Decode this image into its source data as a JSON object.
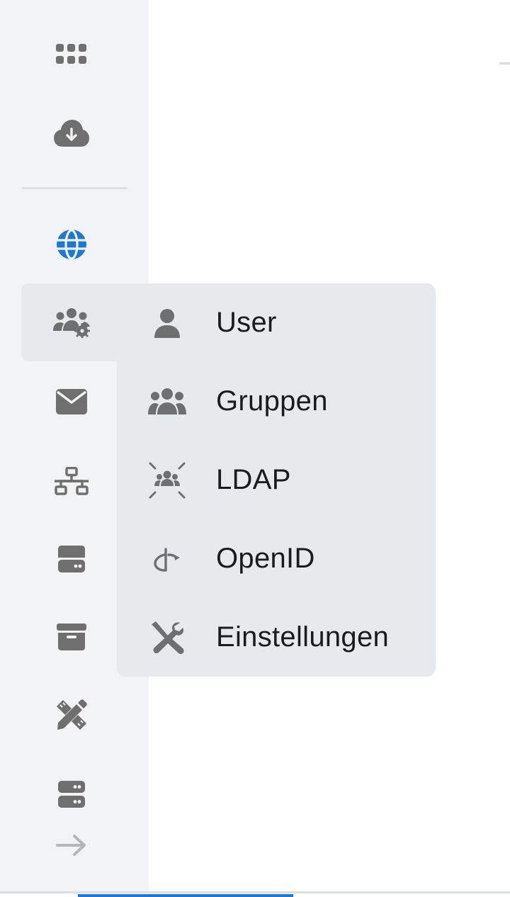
{
  "colors": {
    "icon": "#6f6f6f",
    "icon_active": "#1d78d3",
    "sidebar_bg": "#f2f3f5",
    "flyout_bg": "#e7eaed",
    "accent": "#1d78d3"
  },
  "sidebar": {
    "items": [
      {
        "icon": "apps-grid-icon"
      },
      {
        "icon": "cloud-download-icon"
      },
      {
        "icon": "globe-icon",
        "active_color": true
      },
      {
        "icon": "users-settings-icon",
        "selected": true
      },
      {
        "icon": "mail-icon"
      },
      {
        "icon": "network-icon"
      },
      {
        "icon": "storage-icon"
      },
      {
        "icon": "archive-icon"
      },
      {
        "icon": "tools-icon"
      },
      {
        "icon": "server-icon"
      },
      {
        "icon": "arrow-right-icon"
      }
    ]
  },
  "flyout": {
    "items": [
      {
        "label": "User",
        "icon": "user-icon"
      },
      {
        "label": "Gruppen",
        "icon": "group-icon"
      },
      {
        "label": "LDAP",
        "icon": "ldap-icon"
      },
      {
        "label": "OpenID",
        "icon": "openid-icon"
      },
      {
        "label": "Einstellungen",
        "icon": "wrench-screwdriver-icon"
      }
    ]
  }
}
